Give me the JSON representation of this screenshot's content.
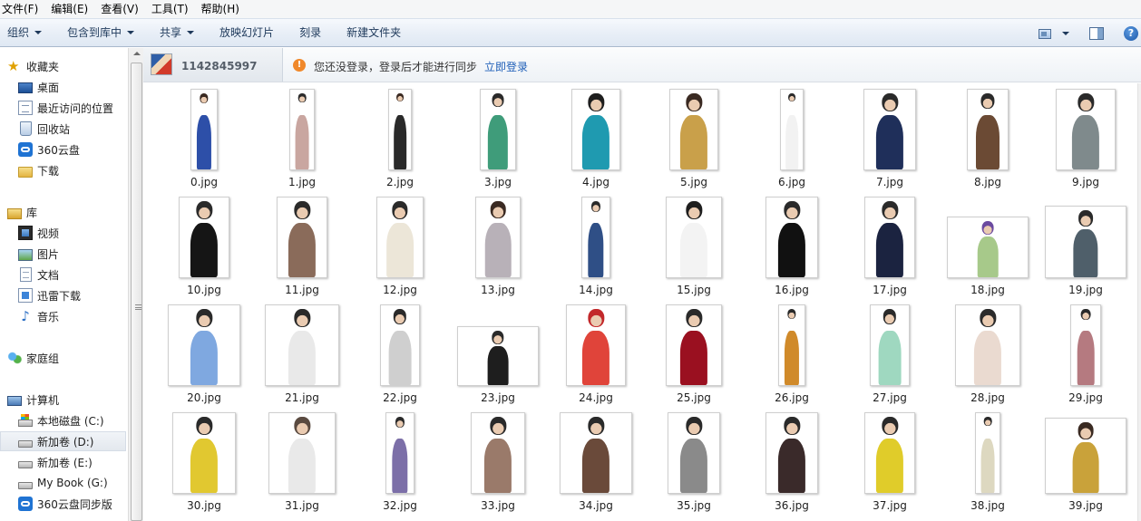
{
  "menu": [
    "文件(F)",
    "编辑(E)",
    "查看(V)",
    "工具(T)",
    "帮助(H)"
  ],
  "toolbar": {
    "buttons": [
      {
        "label": "组织",
        "dropdown": true
      },
      {
        "label": "包含到库中",
        "dropdown": true
      },
      {
        "label": "共享",
        "dropdown": true
      },
      {
        "label": "放映幻灯片",
        "dropdown": false
      },
      {
        "label": "刻录",
        "dropdown": false
      },
      {
        "label": "新建文件夹",
        "dropdown": false
      }
    ],
    "help": "?"
  },
  "nav": {
    "favorites": {
      "label": "收藏夹",
      "items": [
        "桌面",
        "最近访问的位置",
        "回收站",
        "360云盘",
        "下载"
      ]
    },
    "libraries": {
      "label": "库",
      "items": [
        "视频",
        "图片",
        "文档",
        "迅雷下载",
        "音乐"
      ]
    },
    "homegroup": "家庭组",
    "computer": {
      "label": "计算机",
      "items": [
        "本地磁盘 (C:)",
        "新加卷 (D:)",
        "新加卷 (E:)",
        "My Book (G:)",
        "360云盘同步版"
      ],
      "selected": "新加卷 (D:)"
    }
  },
  "infobar": {
    "user_id": "1142845997",
    "message": "您还没登录，登录后才能进行同步",
    "login_link": "立即登录"
  },
  "files": [
    {
      "name": "0.jpg",
      "colors": [
        "#2d4fa8",
        "#3a2a22"
      ]
    },
    {
      "name": "1.jpg",
      "colors": [
        "#c9a6a0",
        "#2b2b2b"
      ]
    },
    {
      "name": "2.jpg",
      "colors": [
        "#2a2a2a",
        "#3a2a22"
      ]
    },
    {
      "name": "3.jpg",
      "colors": [
        "#3f9c7a",
        "#2a2a2a"
      ]
    },
    {
      "name": "4.jpg",
      "colors": [
        "#1f9ab0",
        "#1e1e1e"
      ]
    },
    {
      "name": "5.jpg",
      "colors": [
        "#c9a04a",
        "#3a2a22"
      ]
    },
    {
      "name": "6.jpg",
      "colors": [
        "#f2f2f2",
        "#2a2a2a"
      ]
    },
    {
      "name": "7.jpg",
      "colors": [
        "#1f2f5a",
        "#2a2a2a"
      ]
    },
    {
      "name": "8.jpg",
      "colors": [
        "#6b4a34",
        "#2a2a2a"
      ]
    },
    {
      "name": "9.jpg",
      "colors": [
        "#7f8a8c",
        "#2a2a2a"
      ]
    },
    {
      "name": "10.jpg",
      "colors": [
        "#151515",
        "#2a2a2a"
      ]
    },
    {
      "name": "11.jpg",
      "colors": [
        "#8a6b5a",
        "#2a2a2a"
      ]
    },
    {
      "name": "12.jpg",
      "colors": [
        "#ece6d8",
        "#2a2a2a"
      ]
    },
    {
      "name": "13.jpg",
      "colors": [
        "#b8b1b8",
        "#3a2a22"
      ]
    },
    {
      "name": "14.jpg",
      "colors": [
        "#2f4f86",
        "#2a2a2a"
      ]
    },
    {
      "name": "15.jpg",
      "colors": [
        "#f3f3f3",
        "#1e1e1e"
      ]
    },
    {
      "name": "16.jpg",
      "colors": [
        "#111111",
        "#2a2a2a"
      ]
    },
    {
      "name": "17.jpg",
      "colors": [
        "#1b2340",
        "#2a2a2a"
      ]
    },
    {
      "name": "18.jpg",
      "colors": [
        "#a7c98a",
        "#6b4aa0"
      ]
    },
    {
      "name": "19.jpg",
      "colors": [
        "#4f5f6a",
        "#2a2a2a"
      ]
    },
    {
      "name": "20.jpg",
      "colors": [
        "#7fa8e0",
        "#2a2a2a"
      ]
    },
    {
      "name": "21.jpg",
      "colors": [
        "#e9e9e9",
        "#2a2a2a"
      ]
    },
    {
      "name": "22.jpg",
      "colors": [
        "#cfcfcf",
        "#2a2a2a"
      ]
    },
    {
      "name": "23.jpg",
      "colors": [
        "#1e1e1e",
        "#2a2a2a"
      ]
    },
    {
      "name": "24.jpg",
      "colors": [
        "#e0443a",
        "#c2282a"
      ]
    },
    {
      "name": "25.jpg",
      "colors": [
        "#9a1020",
        "#2a2a2a"
      ]
    },
    {
      "name": "26.jpg",
      "colors": [
        "#d08a2a",
        "#2a2a2a"
      ]
    },
    {
      "name": "27.jpg",
      "colors": [
        "#9fd8c0",
        "#2a2a2a"
      ]
    },
    {
      "name": "28.jpg",
      "colors": [
        "#eadad0",
        "#2a2a2a"
      ]
    },
    {
      "name": "29.jpg",
      "colors": [
        "#b57a80",
        "#2a2a2a"
      ]
    },
    {
      "name": "30.jpg",
      "colors": [
        "#e1c830",
        "#2a2a2a"
      ]
    },
    {
      "name": "31.jpg",
      "colors": [
        "#e9e9e9",
        "#5a4a40"
      ]
    },
    {
      "name": "32.jpg",
      "colors": [
        "#7c6fa8",
        "#2a2a2a"
      ]
    },
    {
      "name": "33.jpg",
      "colors": [
        "#9a7a6a",
        "#2a2a2a"
      ]
    },
    {
      "name": "34.jpg",
      "colors": [
        "#6a4a3a",
        "#2a2a2a"
      ]
    },
    {
      "name": "35.jpg",
      "colors": [
        "#8a8a8a",
        "#2a2a2a"
      ]
    },
    {
      "name": "36.jpg",
      "colors": [
        "#3a2a2a",
        "#2a2a2a"
      ]
    },
    {
      "name": "37.jpg",
      "colors": [
        "#e0cc2a",
        "#2a2a2a"
      ]
    },
    {
      "name": "38.jpg",
      "colors": [
        "#ddd8c0",
        "#2a2a2a"
      ]
    },
    {
      "name": "39.jpg",
      "colors": [
        "#c9a23a",
        "#3a2a22"
      ]
    }
  ]
}
